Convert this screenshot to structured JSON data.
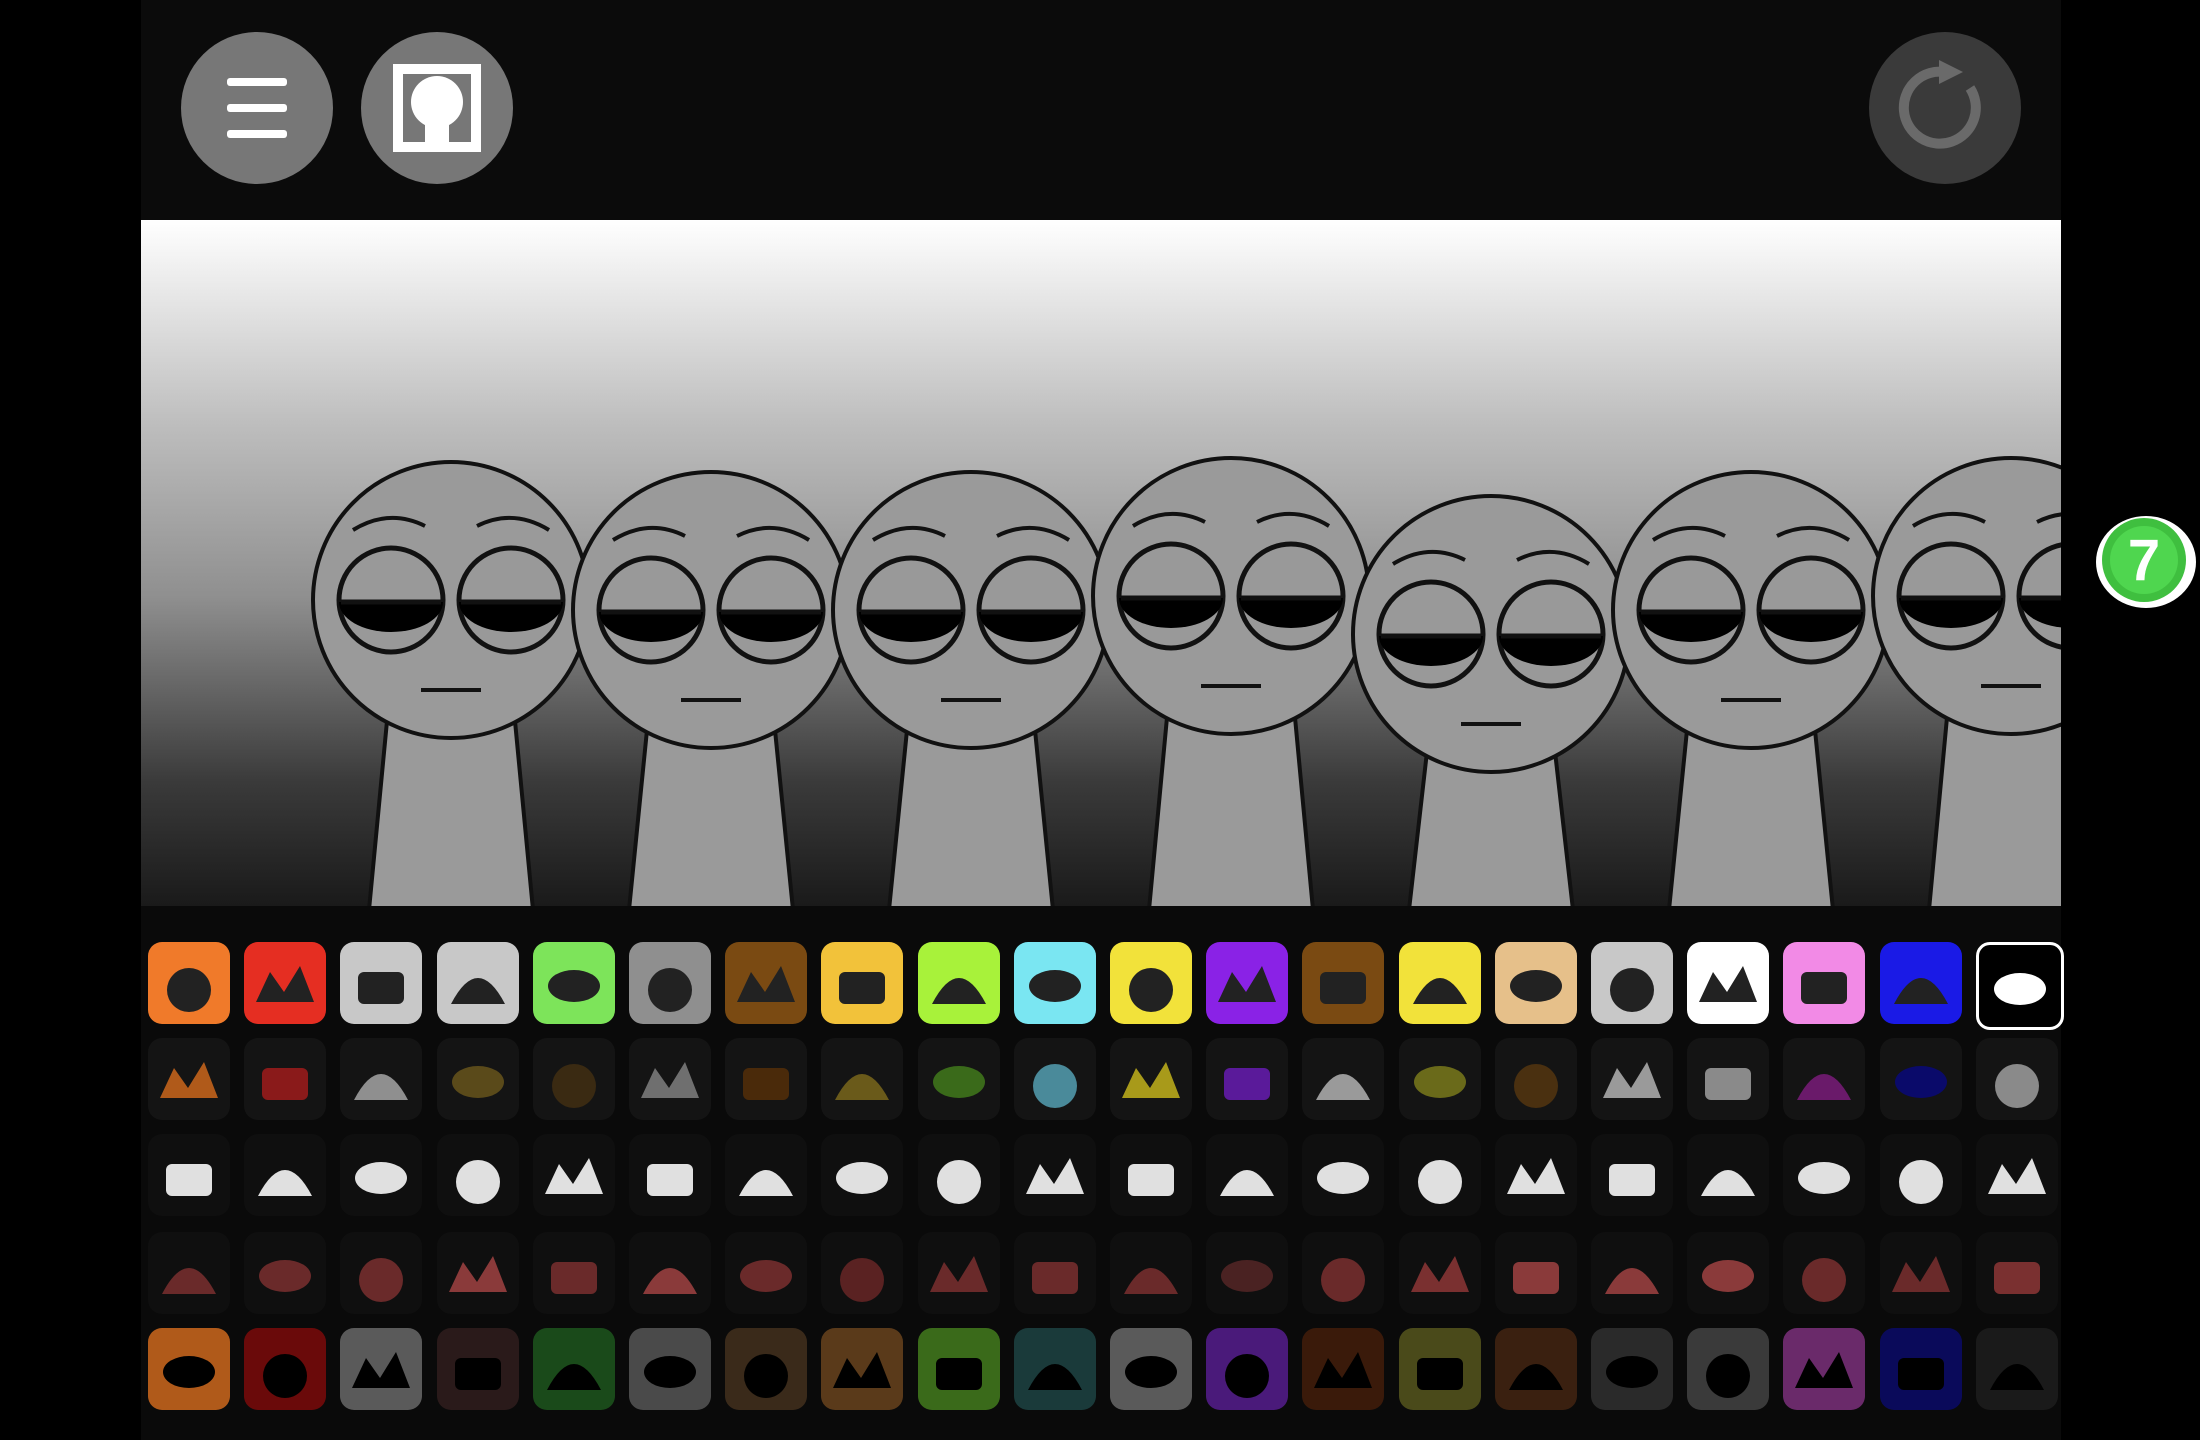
{
  "toolbar": {
    "menu_icon": "hamburger-menu-icon",
    "avatar_icon": "avatar-frame-icon",
    "reset_icon": "reset-icon"
  },
  "badge": {
    "label": "7",
    "color": "#3fbf3f"
  },
  "stage": {
    "characters": [
      {
        "slot": 1,
        "state": "idle"
      },
      {
        "slot": 2,
        "state": "idle"
      },
      {
        "slot": 3,
        "state": "idle"
      },
      {
        "slot": 4,
        "state": "idle"
      },
      {
        "slot": 5,
        "state": "idle"
      },
      {
        "slot": 6,
        "state": "idle"
      },
      {
        "slot": 7,
        "state": "idle"
      }
    ]
  },
  "palette": {
    "rows": [
      {
        "style": "active",
        "icons": [
          {
            "name": "orange-antenna-icon",
            "color": "#f07a2a"
          },
          {
            "name": "red-spiky-icon",
            "color": "#e52e22"
          },
          {
            "name": "silver-dish-icon",
            "color": "#c8c8c8"
          },
          {
            "name": "robot-monitor-icon",
            "color": "#c8c8c8"
          },
          {
            "name": "flower-icon",
            "color": "#7de45a"
          },
          {
            "name": "grey-cat-ears-icon",
            "color": "#8f8f8f"
          },
          {
            "name": "brown-bucket-icon",
            "color": "#7a4a12"
          },
          {
            "name": "yellow-visor-icon",
            "color": "#f2c23a"
          },
          {
            "name": "green-grass-icon",
            "color": "#a8f23a"
          },
          {
            "name": "blue-bear-icon",
            "color": "#7ae6f2"
          },
          {
            "name": "sun-icon",
            "color": "#f2e23a"
          },
          {
            "name": "purple-horns-icon",
            "color": "#8a22e6"
          },
          {
            "name": "tree-icon",
            "color": "#7a4a12"
          },
          {
            "name": "yellow-antenna-icon",
            "color": "#f2e23a"
          },
          {
            "name": "brown-hat-icon",
            "color": "#e6c08a"
          },
          {
            "name": "computer-icon",
            "color": "#c8c8c8"
          },
          {
            "name": "white-envelope-icon",
            "color": "#ffffff"
          },
          {
            "name": "pink-bunny-icon",
            "color": "#f28ae6"
          },
          {
            "name": "blue-ribbon-icon",
            "color": "#1a1ae6"
          },
          {
            "name": "black-top-hat-icon",
            "color": "#000000"
          }
        ]
      },
      {
        "style": "dim",
        "icons": [
          {
            "name": "orange-antenna-dim-icon",
            "color": "#b05a1a"
          },
          {
            "name": "red-spiky-dim-icon",
            "color": "#8a1a1a"
          },
          {
            "name": "silver-dish-dim-icon",
            "color": "#8f8f8f"
          },
          {
            "name": "robot-monitor-dim-icon",
            "color": "#5a4a1a"
          },
          {
            "name": "flower-dim-icon",
            "color": "#3a2a12"
          },
          {
            "name": "grey-cat-ears-dim-icon",
            "color": "#6f6f6f"
          },
          {
            "name": "brown-bucket-dim-icon",
            "color": "#4a2a0a"
          },
          {
            "name": "yellow-visor-dim-icon",
            "color": "#6a5a1a"
          },
          {
            "name": "green-grass-dim-icon",
            "color": "#3a6a1a"
          },
          {
            "name": "blue-bear-dim-icon",
            "color": "#4a8a9a"
          },
          {
            "name": "sun-dim-icon",
            "color": "#a89a1a"
          },
          {
            "name": "purple-horns-dim-icon",
            "color": "#5a1a9a"
          },
          {
            "name": "tree-dim-icon",
            "color": "#9a9a9a"
          },
          {
            "name": "yellow-antenna-dim-icon",
            "color": "#6a6a1a"
          },
          {
            "name": "brown-hat-dim-icon",
            "color": "#4a3010"
          },
          {
            "name": "computer-dim-icon",
            "color": "#9a9a9a"
          },
          {
            "name": "white-envelope-dim-icon",
            "color": "#8a8a8a"
          },
          {
            "name": "pink-bunny-dim-icon",
            "color": "#6a1a6a"
          },
          {
            "name": "blue-ribbon-dim-icon",
            "color": "#0a0a6a"
          },
          {
            "name": "eye-icon",
            "color": "#8a8a8a"
          }
        ]
      },
      {
        "style": "fx-white",
        "icons": [
          {
            "name": "swoosh-icon",
            "color": "#e0e0e0"
          },
          {
            "name": "shard-icon",
            "color": "#e0e0e0"
          },
          {
            "name": "palm-icon",
            "color": "#e0e0e0"
          },
          {
            "name": "robot-head-icon",
            "color": "#e0e0e0"
          },
          {
            "name": "slash-icon",
            "color": "#e0e0e0"
          },
          {
            "name": "cube-icon",
            "color": "#e0e0e0"
          },
          {
            "name": "small-swirl-icon",
            "color": "#e0e0e0"
          },
          {
            "name": "goggles-icon",
            "color": "#e0e0e0"
          },
          {
            "name": "crown-icon",
            "color": "#e0e0e0"
          },
          {
            "name": "bar-icon",
            "color": "#e0e0e0"
          },
          {
            "name": "star-burst-icon",
            "color": "#e0e0e0"
          },
          {
            "name": "arch-icon",
            "color": "#e0e0e0"
          },
          {
            "name": "zigzag-icon",
            "color": "#e0e0e0"
          },
          {
            "name": "frown-icon",
            "color": "#e0e0e0"
          },
          {
            "name": "pill-icon",
            "color": "#e0e0e0"
          },
          {
            "name": "monitor-glow-icon",
            "color": "#e0e0e0"
          },
          {
            "name": "ring-icon",
            "color": "#e0e0e0"
          },
          {
            "name": "curl-icon",
            "color": "#e0e0e0"
          },
          {
            "name": "medal-icon",
            "color": "#e0e0e0"
          },
          {
            "name": "white-hat-icon",
            "color": "#e0e0e0"
          }
        ]
      },
      {
        "style": "fx-red",
        "icons": [
          {
            "name": "swoosh-red-icon",
            "color": "#6a2a2a"
          },
          {
            "name": "shard-red-icon",
            "color": "#6a2a2a"
          },
          {
            "name": "palm-red-icon",
            "color": "#6a2a2a"
          },
          {
            "name": "robot-head-red-icon",
            "color": "#8a3a3a"
          },
          {
            "name": "slash-red-icon",
            "color": "#6a2a2a"
          },
          {
            "name": "cube-red-icon",
            "color": "#8a3a3a"
          },
          {
            "name": "small-swirl-red-icon",
            "color": "#6a2a2a"
          },
          {
            "name": "goggles-red-icon",
            "color": "#5a2222"
          },
          {
            "name": "crown-red-icon",
            "color": "#6a2a2a"
          },
          {
            "name": "bar-red-icon",
            "color": "#6a2a2a"
          },
          {
            "name": "star-burst-red-icon",
            "color": "#6a2a2a"
          },
          {
            "name": "arch-red-icon",
            "color": "#4a2222"
          },
          {
            "name": "zigzag-red-icon",
            "color": "#6a2a2a"
          },
          {
            "name": "frown-red-icon",
            "color": "#7a3030"
          },
          {
            "name": "pill-red-icon",
            "color": "#8a3a3a"
          },
          {
            "name": "monitor-red-icon",
            "color": "#8a3a3a"
          },
          {
            "name": "ball-red-icon",
            "color": "#8a3a3a"
          },
          {
            "name": "curl-red-icon",
            "color": "#6a2a2a"
          },
          {
            "name": "medal-red-icon",
            "color": "#6a2a2a"
          },
          {
            "name": "hat-red-icon",
            "color": "#7a3030"
          }
        ]
      },
      {
        "style": "horror",
        "icons": [
          {
            "name": "orange-eyes-icon",
            "color": "#b05a1a"
          },
          {
            "name": "red-hook-icon",
            "color": "#6a0a0a"
          },
          {
            "name": "grey-tentacles-icon",
            "color": "#5a5a5a"
          },
          {
            "name": "robot-mouth-icon",
            "color": "#2a1a1a"
          },
          {
            "name": "green-orb-icon",
            "color": "#1a4a1a"
          },
          {
            "name": "grey-fangs-icon",
            "color": "#4a4a4a"
          },
          {
            "name": "brown-fin-icon",
            "color": "#3a2a1a"
          },
          {
            "name": "orange-grille-icon",
            "color": "#5a3a1a"
          },
          {
            "name": "green-spikes-icon",
            "color": "#3a6a1a"
          },
          {
            "name": "teal-claws-icon",
            "color": "#1a3a3a"
          },
          {
            "name": "red-eye-icon",
            "color": "#5a5a5a"
          },
          {
            "name": "purple-demon-icon",
            "color": "#4a1a7a"
          },
          {
            "name": "red-disc-icon",
            "color": "#3a1a0a"
          },
          {
            "name": "olive-bug-icon",
            "color": "#4a4a1a"
          },
          {
            "name": "red-teeth-icon",
            "color": "#3a2010"
          },
          {
            "name": "dark-monitor-icon",
            "color": "#2a2a2a"
          },
          {
            "name": "grey-mask-icon",
            "color": "#3a3a3a"
          },
          {
            "name": "pink-box-icon",
            "color": "#6a2a6a"
          },
          {
            "name": "blue-shadow-icon",
            "color": "#0a0a5a"
          },
          {
            "name": "white-slit-icon",
            "color": "#1a1a1a"
          }
        ]
      }
    ]
  }
}
